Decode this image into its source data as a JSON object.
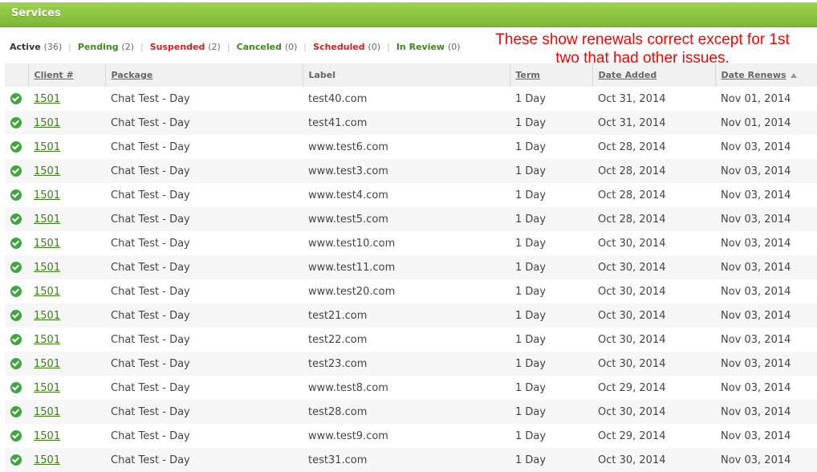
{
  "header": {
    "title": "Services"
  },
  "filters": [
    {
      "label": "Active",
      "count": "(36)",
      "color": "#333333"
    },
    {
      "label": "Pending",
      "count": "(2)",
      "color": "#3a8a1a"
    },
    {
      "label": "Suspended",
      "count": "(2)",
      "color": "#cc2222"
    },
    {
      "label": "Canceled",
      "count": "(0)",
      "color": "#3a8a1a"
    },
    {
      "label": "Scheduled",
      "count": "(0)",
      "color": "#cc2222"
    },
    {
      "label": "In Review",
      "count": "(0)",
      "color": "#3a8a1a"
    }
  ],
  "annotation": "These show renewals correct except for 1st two that had other issues.",
  "table": {
    "columns": [
      "Client #",
      "Package",
      "Label",
      "Term",
      "Date Added",
      "Date Renews"
    ],
    "rows": [
      [
        "1501",
        "Chat Test - Day",
        "test40.com",
        "1 Day",
        "Oct 31, 2014",
        "Nov 01, 2014"
      ],
      [
        "1501",
        "Chat Test - Day",
        "test41.com",
        "1 Day",
        "Oct 31, 2014",
        "Nov 01, 2014"
      ],
      [
        "1501",
        "Chat Test - Day",
        "www.test6.com",
        "1 Day",
        "Oct 28, 2014",
        "Nov 03, 2014"
      ],
      [
        "1501",
        "Chat Test - Day",
        "www.test3.com",
        "1 Day",
        "Oct 28, 2014",
        "Nov 03, 2014"
      ],
      [
        "1501",
        "Chat Test - Day",
        "www.test4.com",
        "1 Day",
        "Oct 28, 2014",
        "Nov 03, 2014"
      ],
      [
        "1501",
        "Chat Test - Day",
        "www.test5.com",
        "1 Day",
        "Oct 28, 2014",
        "Nov 03, 2014"
      ],
      [
        "1501",
        "Chat Test - Day",
        "www.test10.com",
        "1 Day",
        "Oct 30, 2014",
        "Nov 03, 2014"
      ],
      [
        "1501",
        "Chat Test - Day",
        "www.test11.com",
        "1 Day",
        "Oct 30, 2014",
        "Nov 03, 2014"
      ],
      [
        "1501",
        "Chat Test - Day",
        "www.test20.com",
        "1 Day",
        "Oct 30, 2014",
        "Nov 03, 2014"
      ],
      [
        "1501",
        "Chat Test - Day",
        "test21.com",
        "1 Day",
        "Oct 30, 2014",
        "Nov 03, 2014"
      ],
      [
        "1501",
        "Chat Test - Day",
        "test22.com",
        "1 Day",
        "Oct 30, 2014",
        "Nov 03, 2014"
      ],
      [
        "1501",
        "Chat Test - Day",
        "test23.com",
        "1 Day",
        "Oct 30, 2014",
        "Nov 03, 2014"
      ],
      [
        "1501",
        "Chat Test - Day",
        "www.test8.com",
        "1 Day",
        "Oct 29, 2014",
        "Nov 03, 2014"
      ],
      [
        "1501",
        "Chat Test - Day",
        "test28.com",
        "1 Day",
        "Oct 30, 2014",
        "Nov 03, 2014"
      ],
      [
        "1501",
        "Chat Test - Day",
        "www.test9.com",
        "1 Day",
        "Oct 29, 2014",
        "Nov 03, 2014"
      ],
      [
        "1501",
        "Chat Test - Day",
        "test31.com",
        "1 Day",
        "Oct 30, 2014",
        "Nov 03, 2014"
      ]
    ],
    "status_icon": "check-circle-icon",
    "sort_icon": "sort-ascending-icon"
  }
}
